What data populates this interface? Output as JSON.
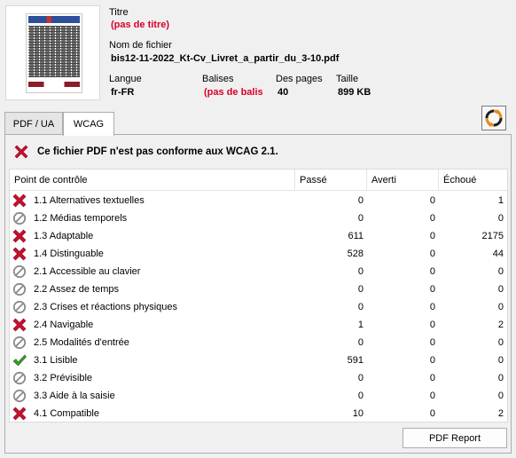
{
  "document": {
    "title_label": "Titre",
    "title_value": "(pas de titre)",
    "filename_label": "Nom de fichier",
    "filename_value": "bis12-11-2022_Kt-Cv_Livret_a_partir_du_3-10.pdf",
    "language_label": "Langue",
    "language_value": "fr-FR",
    "tags_label": "Balises",
    "tags_value": "(pas de balis",
    "pages_label": "Des pages",
    "pages_value": "40",
    "size_label": "Taille",
    "size_value": "899 KB"
  },
  "tabs": [
    {
      "label": "PDF / UA",
      "active": false
    },
    {
      "label": "WCAG",
      "active": true
    }
  ],
  "status": {
    "icon": "fail-x-icon",
    "text": "Ce fichier PDF n'est pas conforme aux WCAG 2.1."
  },
  "table": {
    "headers": [
      "Point de contrôle",
      "Passé",
      "Averti",
      "Échoué"
    ],
    "rows": [
      {
        "status": "fail",
        "name": "1.1 Alternatives textuelles",
        "passed": "0",
        "warned": "0",
        "failed": "1"
      },
      {
        "status": "na",
        "name": "1.2 Médias temporels",
        "passed": "0",
        "warned": "0",
        "failed": "0"
      },
      {
        "status": "fail",
        "name": "1.3 Adaptable",
        "passed": "611",
        "warned": "0",
        "failed": "2175"
      },
      {
        "status": "fail",
        "name": "1.4 Distinguable",
        "passed": "528",
        "warned": "0",
        "failed": "44"
      },
      {
        "status": "na",
        "name": "2.1 Accessible au clavier",
        "passed": "0",
        "warned": "0",
        "failed": "0"
      },
      {
        "status": "na",
        "name": "2.2 Assez de temps",
        "passed": "0",
        "warned": "0",
        "failed": "0"
      },
      {
        "status": "na",
        "name": "2.3 Crises et réactions physiques",
        "passed": "0",
        "warned": "0",
        "failed": "0"
      },
      {
        "status": "fail",
        "name": "2.4 Navigable",
        "passed": "1",
        "warned": "0",
        "failed": "2"
      },
      {
        "status": "na",
        "name": "2.5 Modalités d'entrée",
        "passed": "0",
        "warned": "0",
        "failed": "0"
      },
      {
        "status": "pass",
        "name": "3.1 Lisible",
        "passed": "591",
        "warned": "0",
        "failed": "0"
      },
      {
        "status": "na",
        "name": "3.2 Prévisible",
        "passed": "0",
        "warned": "0",
        "failed": "0"
      },
      {
        "status": "na",
        "name": "3.3 Aide à la saisie",
        "passed": "0",
        "warned": "0",
        "failed": "0"
      },
      {
        "status": "fail",
        "name": "4.1 Compatible",
        "passed": "10",
        "warned": "0",
        "failed": "2"
      }
    ]
  },
  "buttons": {
    "pdf_report": "PDF Report",
    "refresh_icon": "refresh-icon"
  },
  "colors": {
    "fail_red": "#c8102e",
    "pass_green": "#3a9a2a",
    "na_gray": "#8a8a8a",
    "value_red": "#d9002a"
  }
}
